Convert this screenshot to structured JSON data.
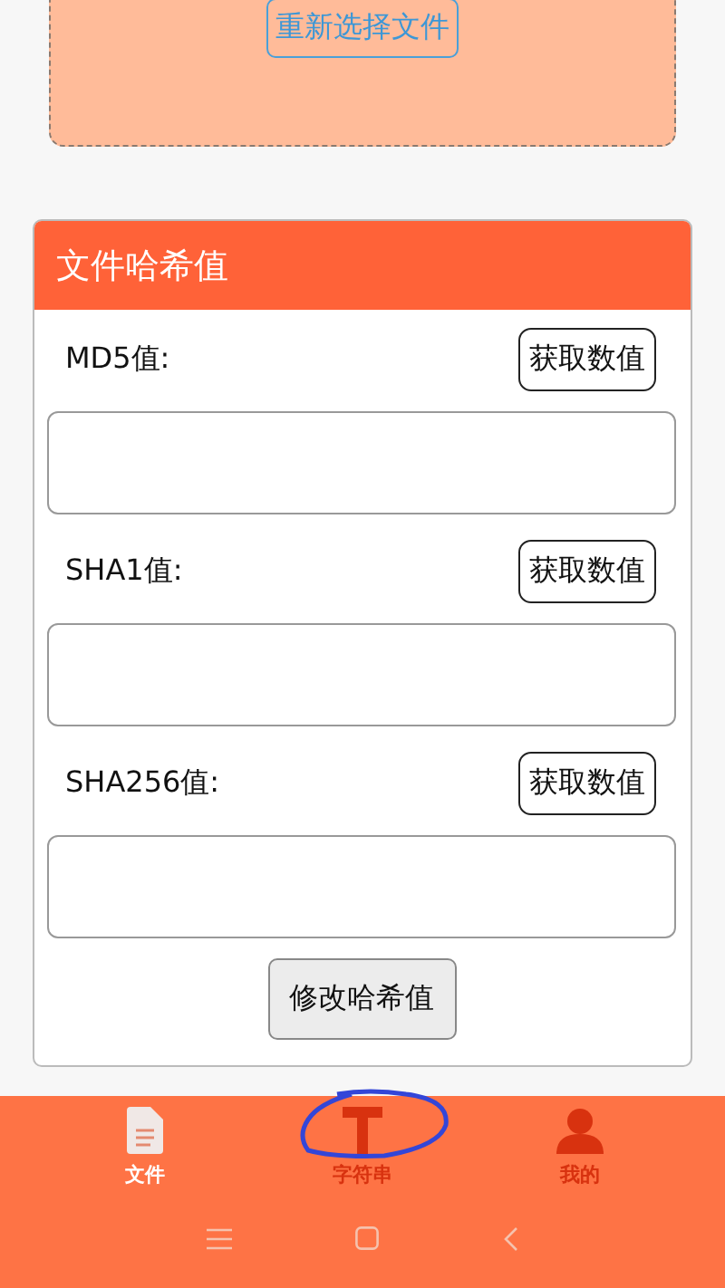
{
  "upload": {
    "button": "重新选择文件"
  },
  "card": {
    "title": "文件哈希值",
    "rows": [
      {
        "label": "MD5值:",
        "button": "获取数值"
      },
      {
        "label": "SHA1值:",
        "button": "获取数值"
      },
      {
        "label": "SHA256值:",
        "button": "获取数值"
      }
    ],
    "footer_button": "修改哈希值"
  },
  "bottom_nav": {
    "tabs": [
      {
        "kind": "file",
        "label": "文件",
        "selected": true
      },
      {
        "kind": "text",
        "label": "字符串",
        "selected": false
      },
      {
        "kind": "user",
        "label": "我的",
        "selected": false
      }
    ]
  }
}
